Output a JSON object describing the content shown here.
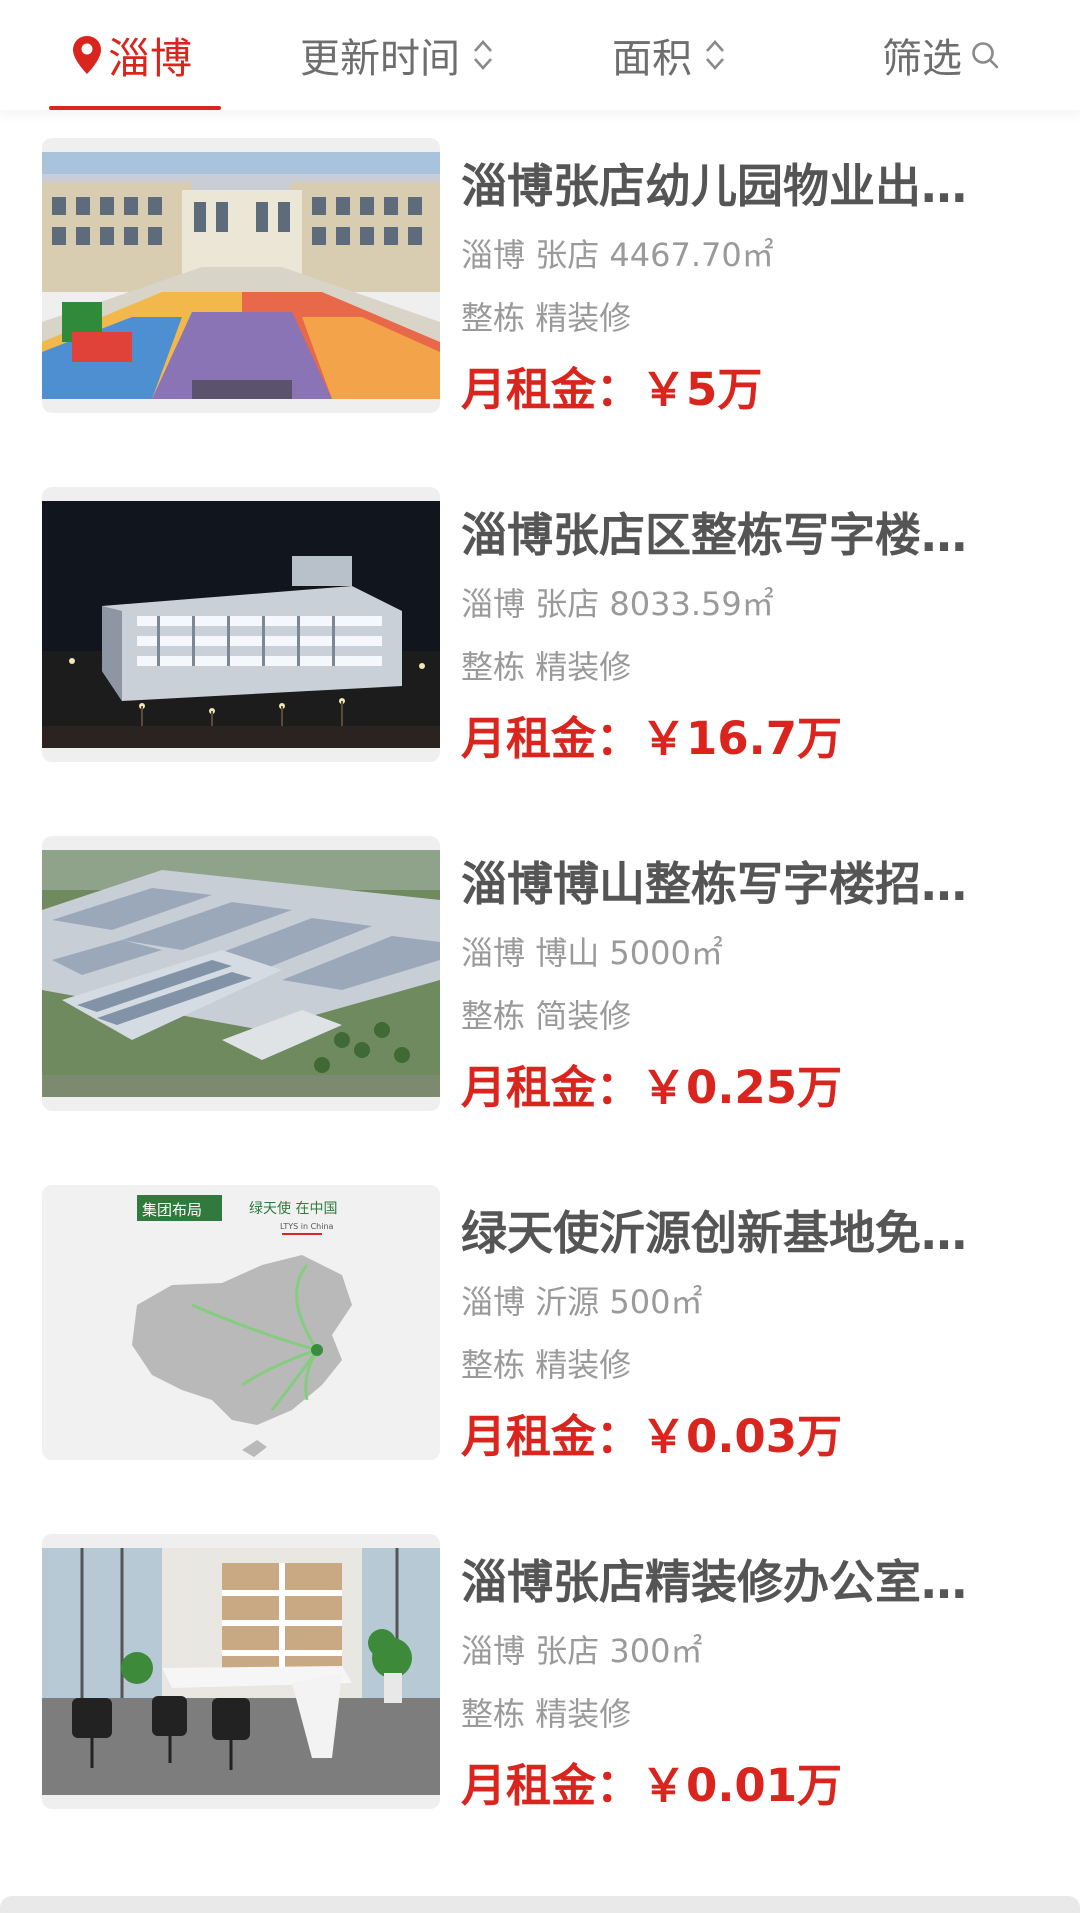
{
  "filter_bar": {
    "city": "淄博",
    "sort_time": "更新时间",
    "sort_area": "面积",
    "filter": "筛选"
  },
  "colors": {
    "accent": "#d9251d",
    "title": "#555555",
    "meta": "#9a9a9a"
  },
  "listings": [
    {
      "title": "淄博张店幼儿园物业出租…",
      "city": "淄博",
      "district": "张店",
      "area": "4467.70㎡",
      "structure": "整栋",
      "decoration": "精装修",
      "price_label": "月租金：",
      "price": "￥5万",
      "image": "kindergarten-building-photo"
    },
    {
      "title": "淄博张店区整栋写字楼出…",
      "city": "淄博",
      "district": "张店",
      "area": "8033.59㎡",
      "structure": "整栋",
      "decoration": "精装修",
      "price_label": "月租金：",
      "price": "￥16.7万",
      "image": "office-building-night-photo"
    },
    {
      "title": "淄博博山整栋写字楼招租…",
      "city": "淄博",
      "district": "博山",
      "area": "5000㎡",
      "structure": "整栋",
      "decoration": "简装修",
      "price_label": "月租金：",
      "price": "￥0.25万",
      "image": "industrial-park-aerial-photo"
    },
    {
      "title": "绿天使沂源创新基地免租…",
      "city": "淄博",
      "district": "沂源",
      "area": "500㎡",
      "structure": "整栋",
      "decoration": "精装修",
      "price_label": "月租金：",
      "price": "￥0.03万",
      "image": "china-map-graphic",
      "image_text": {
        "badge": "集团布局",
        "heading": "绿天使 在中国",
        "sub": "LTYS in China"
      }
    },
    {
      "title": "淄博张店精装修办公室招…",
      "city": "淄博",
      "district": "张店",
      "area": "300㎡",
      "structure": "整栋",
      "decoration": "精装修",
      "price_label": "月租金：",
      "price": "￥0.01万",
      "image": "office-interior-photo"
    }
  ]
}
